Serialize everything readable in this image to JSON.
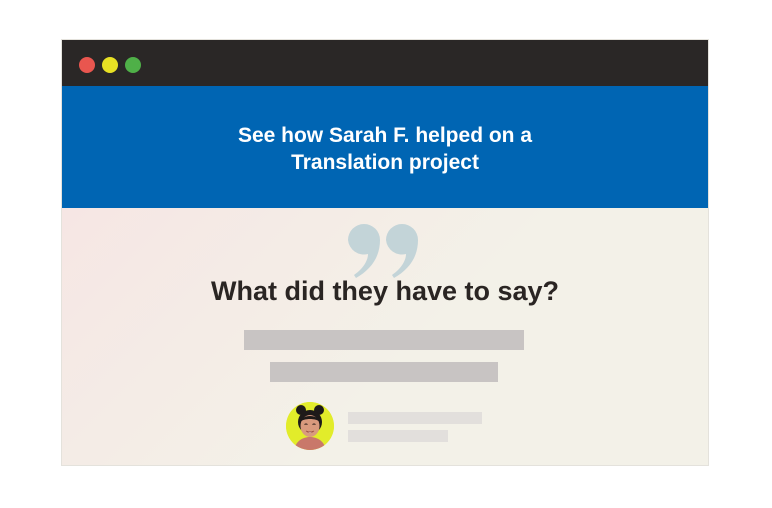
{
  "window": {
    "controls": [
      "close",
      "minimize",
      "maximize"
    ],
    "colors": {
      "close": "#e9564f",
      "minimize": "#e8e124",
      "maximize": "#4fb048"
    }
  },
  "banner": {
    "title_line1": "See how Sarah F. helped on a",
    "title_line2": "Translation project",
    "background": "#0065b3"
  },
  "testimonial": {
    "quote_icon": "quote-icon",
    "heading": "What did they have to say?",
    "avatar_icon": "user-avatar",
    "placeholder_lines": 2
  }
}
